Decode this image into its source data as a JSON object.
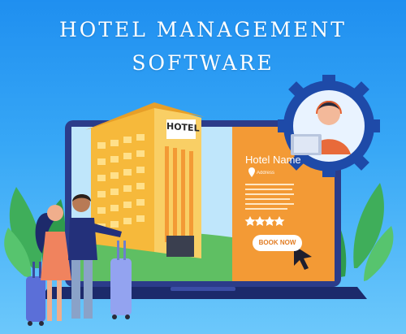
{
  "title": {
    "line1": "HOTEL MANAGEMENT",
    "line2": "SOFTWARE"
  },
  "building_sign": "HOTEL",
  "listing": {
    "hotel_name": "Hotel Name",
    "address": "Address",
    "rating_stars": 4,
    "book_button_label": "BOOK NOW"
  },
  "colors": {
    "background_top": "#1f8ff0",
    "panel_orange": "#f39a35",
    "laptop_frame": "#2b3c8a",
    "building": "#f6b93b",
    "support_gear": "#1e4aa8"
  },
  "icons": [
    "location-pin-icon",
    "star-icon",
    "cursor-arrow-icon",
    "support-agent-icon",
    "gear-icon"
  ]
}
